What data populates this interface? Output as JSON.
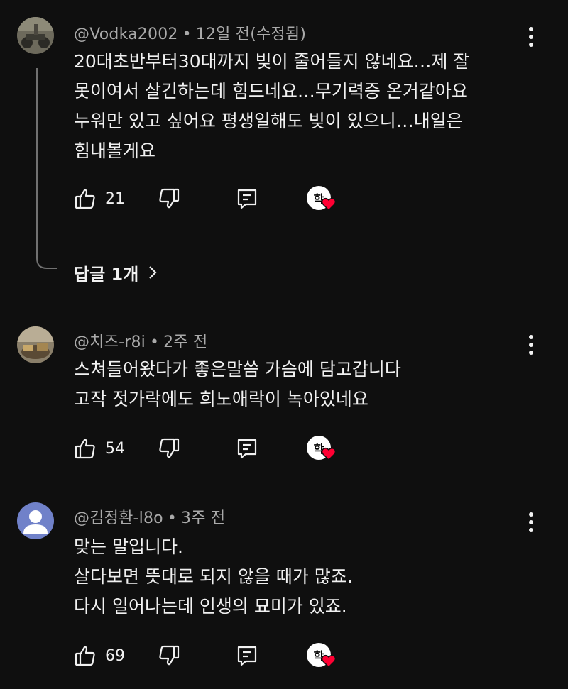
{
  "comments": [
    {
      "author": "@Vodka2002",
      "time": "12일 전(수정됨)",
      "lines": [
        "20대초반부터30대까지 빚이 줄어들지 않네요…제 잘",
        "못이여서 살긴하는데 힘드네요…무기력증 온거같아요",
        "누워만 있고 싶어요 평생일해도 빚이 있으니…내일은",
        "힘내볼게요"
      ],
      "likes": "21",
      "creator_heart_glyph": "학",
      "replies_label": "답글 1개",
      "avatar_icon": "user-photo-avatar"
    },
    {
      "author": "@치즈-r8i",
      "time": "2주 전",
      "lines": [
        "스쳐들어왔다가 좋은말씀 가슴에 담고갑니다",
        "고작 젓가락에도 희노애락이 녹아있네요"
      ],
      "likes": "54",
      "creator_heart_glyph": "학",
      "avatar_icon": "user-photo-avatar"
    },
    {
      "author": "@김정환-l8o",
      "time": "3주 전",
      "lines": [
        "맞는 말입니다.",
        "살다보면 뜻대로 되지 않을 때가 많죠.",
        "다시 일어나는데 인생의 묘미가 있죠."
      ],
      "likes": "69",
      "creator_heart_glyph": "학",
      "avatar_icon": "default-person-avatar"
    }
  ],
  "separator": "•",
  "colors": {
    "background": "#0f0f0f",
    "text": "#f1f1f1",
    "meta": "#aaaaaa",
    "heart": "#ff0033",
    "default_avatar_bg": "#7081c9"
  },
  "icons": {
    "like": "thumb-up-icon",
    "dislike": "thumb-down-icon",
    "reply": "reply-icon",
    "more": "more-vert-icon",
    "chevron": "chevron-right-icon",
    "heart": "heart-icon"
  }
}
